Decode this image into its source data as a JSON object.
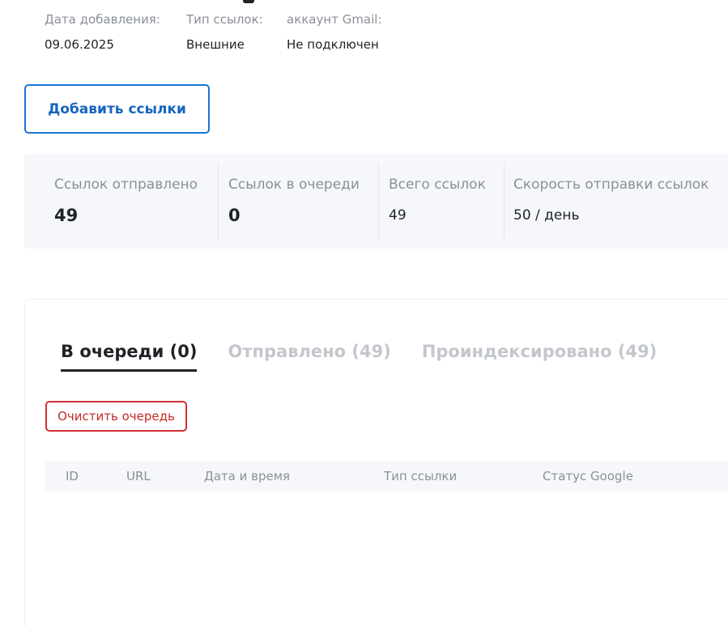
{
  "meta": {
    "date_label": "Дата добавления:",
    "date_value": "09.06.2025",
    "type_label": "Тип ссылок:",
    "type_value": "Внешние",
    "gmail_label": "аккаунт Gmail:",
    "gmail_value": "Не подключен"
  },
  "actions": {
    "add_links_label": "Добавить ссылки",
    "clear_queue_label": "Очистить очередь"
  },
  "stats": [
    {
      "label": "Ссылок отправлено",
      "value": "49"
    },
    {
      "label": "Ссылок в очереди",
      "value": "0"
    },
    {
      "label": "Всего ссылок",
      "value": "49"
    },
    {
      "label": "Скорость отправки ссылок",
      "value": "50 / день"
    }
  ],
  "tabs": [
    {
      "label": "В очереди (0)",
      "active": true
    },
    {
      "label": "Отправлено (49)",
      "active": false
    },
    {
      "label": "Проиндексировано (49)",
      "active": false
    }
  ],
  "table": {
    "columns": [
      "ID",
      "URL",
      "Дата и время",
      "Тип ссылки",
      "Статус Google"
    ],
    "rows": []
  },
  "colors": {
    "primary": "#1976d2",
    "danger": "#d32f2f",
    "muted": "#8a8f98",
    "panel_bg": "#f5f7fb"
  }
}
